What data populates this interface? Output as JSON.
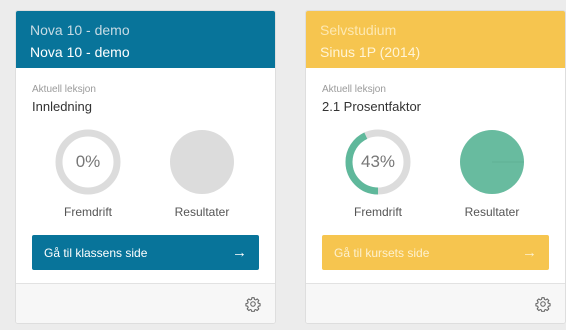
{
  "cards": [
    {
      "header": {
        "subtitle": "Nova 10 - demo",
        "title": "Nova 10 - demo"
      },
      "lesson": {
        "label": "Aktuell leksjon",
        "name": "Innledning"
      },
      "progress": {
        "value_text": "0%",
        "fraction": 0.0,
        "caption": "Fremdrift"
      },
      "results": {
        "caption": "Resultater",
        "fraction": 0.0
      },
      "cta": {
        "label": "Gå til klassens side",
        "icon": "arrow-right-icon"
      },
      "settings_icon": "gear-icon",
      "colors": {
        "accent": "#08749a",
        "ring_fill": "#5fb89b",
        "track": "#dcdcdc",
        "pie_empty": "#dcdcdc"
      }
    },
    {
      "header": {
        "subtitle": "Selvstudium",
        "title": "Sinus 1P (2014)"
      },
      "lesson": {
        "label": "Aktuell leksjon",
        "name": "2.1 Prosentfaktor"
      },
      "progress": {
        "value_text": "43%",
        "fraction": 0.43,
        "caption": "Fremdrift"
      },
      "results": {
        "caption": "Resultater",
        "fraction": 1.0
      },
      "cta": {
        "label": "Gå til kursets side",
        "icon": "arrow-right-icon"
      },
      "settings_icon": "gear-icon",
      "colors": {
        "accent": "#f6c54f",
        "ring_fill": "#5fb89b",
        "track": "#dcdcdc",
        "pie_fill": "#68bb9f"
      }
    }
  ]
}
